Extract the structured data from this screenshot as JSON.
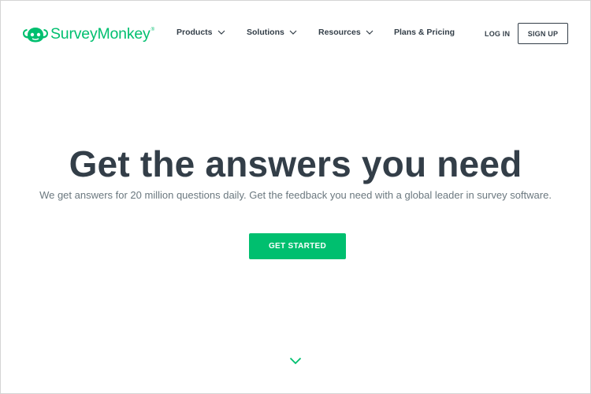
{
  "brand": {
    "name": "SurveyMonkey",
    "registered_mark": "®",
    "color": "#00bf6f"
  },
  "nav": {
    "items": [
      {
        "label": "Products",
        "icon": "chevron-down-icon"
      },
      {
        "label": "Solutions",
        "icon": "chevron-down-icon"
      },
      {
        "label": "Resources",
        "icon": "chevron-down-icon"
      },
      {
        "label": "Plans & Pricing"
      }
    ],
    "login_label": "LOG IN",
    "signup_label": "SIGN UP"
  },
  "hero": {
    "title": "Get the answers you need",
    "subtitle": "We get answers for 20 million questions daily. Get the feedback you need with a global leader in survey software.",
    "cta_label": "GET STARTED",
    "scroll_icon": "chevron-down-icon"
  },
  "colors": {
    "text": "#333e48",
    "muted": "#6b787f",
    "accent": "#00bf6f"
  }
}
